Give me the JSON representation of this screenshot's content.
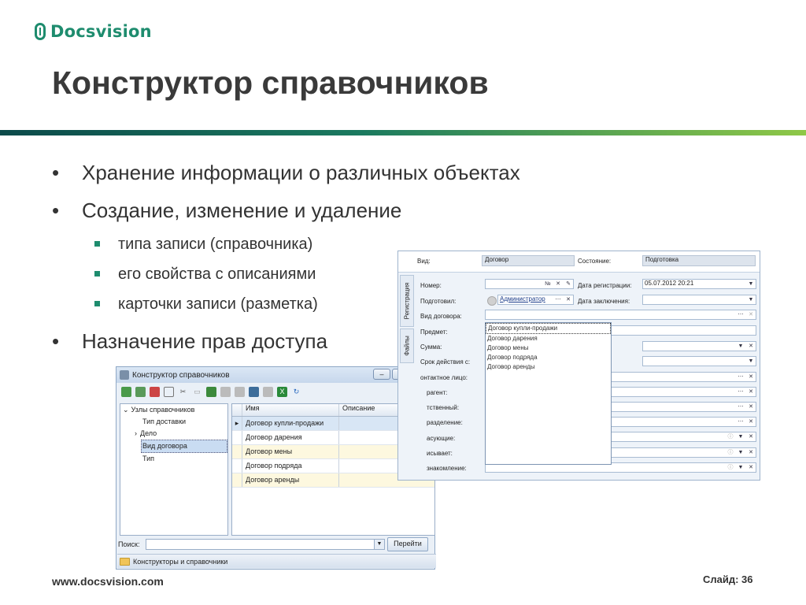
{
  "brand": {
    "name": "Docsvision",
    "color": "#1e8c6e"
  },
  "slide": {
    "title": "Конструктор справочников",
    "bullets": [
      "Хранение информации о различных объектах",
      "Создание, изменение и удаление"
    ],
    "sub_bullets": [
      "типа записи (справочника)",
      "его свойства с описаниями",
      "карточки записи (разметка)"
    ],
    "last_bullet": "Назначение прав доступа",
    "footer_url": "www.docsvision.com",
    "slide_number": "Слайд: 36"
  },
  "dialog": {
    "title": "Конструктор справочников",
    "tree": {
      "root": "Узлы справочников",
      "items": [
        "Тип доставки",
        "Дело",
        "Вид договора",
        "Тип"
      ],
      "selected": "Вид договора"
    },
    "grid": {
      "columns": [
        "Имя",
        "Описание"
      ],
      "rows": [
        "Договор купли-продажи",
        "Договор дарения",
        "Договор мены",
        "Договор подряда",
        "Договор аренды"
      ]
    },
    "search_label": "Поиск:",
    "search_value": "",
    "find_button": "Перейти",
    "status": "Конструкторы и справочники"
  },
  "card": {
    "kind_label": "Вид:",
    "kind_value": "Договор",
    "state_label": "Состояние:",
    "state_value": "Подготовка",
    "tabs": [
      "Регистрация",
      "Файлы"
    ],
    "labels": {
      "number": "Номер:",
      "prepared": "Подготовил:",
      "contract_type": "Вид договора:",
      "subject": "Предмет:",
      "sum": "Сумма:",
      "term": "Срок действия с:",
      "contact": "онтактное лицо:",
      "counterparty": "рагент:",
      "responsible": "тственный:",
      "department": "разделение:",
      "approvers": "асующие:",
      "signer": "исывает:",
      "acquaint": "знакомление:",
      "reg_date": "Дата регистрации:",
      "concl_date": "Дата заключения:"
    },
    "number_sign": "№",
    "reg_date_value": "05.07.2012 20:21",
    "prepared_value": "Администратор",
    "dropdown": [
      "Договор купли-продажи",
      "Договор дарения",
      "Договор мены",
      "Договор подряда",
      "Договор аренды"
    ]
  }
}
